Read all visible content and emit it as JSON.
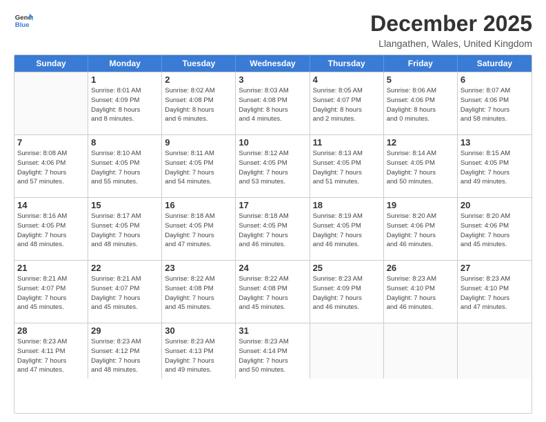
{
  "logo": {
    "general": "General",
    "blue": "Blue"
  },
  "title": "December 2025",
  "location": "Llangathen, Wales, United Kingdom",
  "weekdays": [
    "Sunday",
    "Monday",
    "Tuesday",
    "Wednesday",
    "Thursday",
    "Friday",
    "Saturday"
  ],
  "rows": [
    [
      {
        "day": "",
        "info": ""
      },
      {
        "day": "1",
        "info": "Sunrise: 8:01 AM\nSunset: 4:09 PM\nDaylight: 8 hours\nand 8 minutes."
      },
      {
        "day": "2",
        "info": "Sunrise: 8:02 AM\nSunset: 4:08 PM\nDaylight: 8 hours\nand 6 minutes."
      },
      {
        "day": "3",
        "info": "Sunrise: 8:03 AM\nSunset: 4:08 PM\nDaylight: 8 hours\nand 4 minutes."
      },
      {
        "day": "4",
        "info": "Sunrise: 8:05 AM\nSunset: 4:07 PM\nDaylight: 8 hours\nand 2 minutes."
      },
      {
        "day": "5",
        "info": "Sunrise: 8:06 AM\nSunset: 4:06 PM\nDaylight: 8 hours\nand 0 minutes."
      },
      {
        "day": "6",
        "info": "Sunrise: 8:07 AM\nSunset: 4:06 PM\nDaylight: 7 hours\nand 58 minutes."
      }
    ],
    [
      {
        "day": "7",
        "info": "Sunrise: 8:08 AM\nSunset: 4:06 PM\nDaylight: 7 hours\nand 57 minutes."
      },
      {
        "day": "8",
        "info": "Sunrise: 8:10 AM\nSunset: 4:05 PM\nDaylight: 7 hours\nand 55 minutes."
      },
      {
        "day": "9",
        "info": "Sunrise: 8:11 AM\nSunset: 4:05 PM\nDaylight: 7 hours\nand 54 minutes."
      },
      {
        "day": "10",
        "info": "Sunrise: 8:12 AM\nSunset: 4:05 PM\nDaylight: 7 hours\nand 53 minutes."
      },
      {
        "day": "11",
        "info": "Sunrise: 8:13 AM\nSunset: 4:05 PM\nDaylight: 7 hours\nand 51 minutes."
      },
      {
        "day": "12",
        "info": "Sunrise: 8:14 AM\nSunset: 4:05 PM\nDaylight: 7 hours\nand 50 minutes."
      },
      {
        "day": "13",
        "info": "Sunrise: 8:15 AM\nSunset: 4:05 PM\nDaylight: 7 hours\nand 49 minutes."
      }
    ],
    [
      {
        "day": "14",
        "info": "Sunrise: 8:16 AM\nSunset: 4:05 PM\nDaylight: 7 hours\nand 48 minutes."
      },
      {
        "day": "15",
        "info": "Sunrise: 8:17 AM\nSunset: 4:05 PM\nDaylight: 7 hours\nand 48 minutes."
      },
      {
        "day": "16",
        "info": "Sunrise: 8:18 AM\nSunset: 4:05 PM\nDaylight: 7 hours\nand 47 minutes."
      },
      {
        "day": "17",
        "info": "Sunrise: 8:18 AM\nSunset: 4:05 PM\nDaylight: 7 hours\nand 46 minutes."
      },
      {
        "day": "18",
        "info": "Sunrise: 8:19 AM\nSunset: 4:05 PM\nDaylight: 7 hours\nand 46 minutes."
      },
      {
        "day": "19",
        "info": "Sunrise: 8:20 AM\nSunset: 4:06 PM\nDaylight: 7 hours\nand 46 minutes."
      },
      {
        "day": "20",
        "info": "Sunrise: 8:20 AM\nSunset: 4:06 PM\nDaylight: 7 hours\nand 45 minutes."
      }
    ],
    [
      {
        "day": "21",
        "info": "Sunrise: 8:21 AM\nSunset: 4:07 PM\nDaylight: 7 hours\nand 45 minutes."
      },
      {
        "day": "22",
        "info": "Sunrise: 8:21 AM\nSunset: 4:07 PM\nDaylight: 7 hours\nand 45 minutes."
      },
      {
        "day": "23",
        "info": "Sunrise: 8:22 AM\nSunset: 4:08 PM\nDaylight: 7 hours\nand 45 minutes."
      },
      {
        "day": "24",
        "info": "Sunrise: 8:22 AM\nSunset: 4:08 PM\nDaylight: 7 hours\nand 45 minutes."
      },
      {
        "day": "25",
        "info": "Sunrise: 8:23 AM\nSunset: 4:09 PM\nDaylight: 7 hours\nand 46 minutes."
      },
      {
        "day": "26",
        "info": "Sunrise: 8:23 AM\nSunset: 4:10 PM\nDaylight: 7 hours\nand 46 minutes."
      },
      {
        "day": "27",
        "info": "Sunrise: 8:23 AM\nSunset: 4:10 PM\nDaylight: 7 hours\nand 47 minutes."
      }
    ],
    [
      {
        "day": "28",
        "info": "Sunrise: 8:23 AM\nSunset: 4:11 PM\nDaylight: 7 hours\nand 47 minutes."
      },
      {
        "day": "29",
        "info": "Sunrise: 8:23 AM\nSunset: 4:12 PM\nDaylight: 7 hours\nand 48 minutes."
      },
      {
        "day": "30",
        "info": "Sunrise: 8:23 AM\nSunset: 4:13 PM\nDaylight: 7 hours\nand 49 minutes."
      },
      {
        "day": "31",
        "info": "Sunrise: 8:23 AM\nSunset: 4:14 PM\nDaylight: 7 hours\nand 50 minutes."
      },
      {
        "day": "",
        "info": ""
      },
      {
        "day": "",
        "info": ""
      },
      {
        "day": "",
        "info": ""
      }
    ]
  ]
}
